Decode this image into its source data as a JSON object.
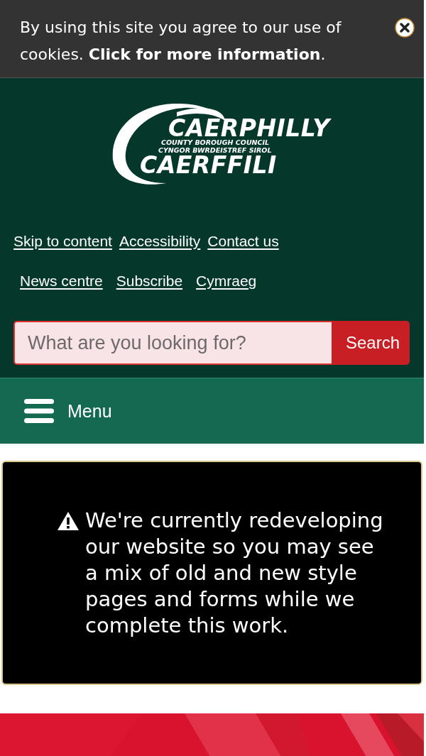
{
  "cookie_banner": {
    "text": "By using this site you agree to our use of cookies.",
    "link": "Click for more information",
    "text_after": "."
  },
  "logo": {
    "lines": [
      "CAERPHILLY",
      "COUNTY BOROUGH COUNCIL",
      "CYNGOR BWRDEISTREF SIROL",
      "CAERFFILI"
    ]
  },
  "link_rows": [
    [
      "Skip to content",
      "Accessibility",
      "Contact us"
    ],
    [
      "News centre",
      "Subscribe",
      "Cymraeg"
    ]
  ],
  "search": {
    "placeholder": "What are you looking for?",
    "button": "Search"
  },
  "menu": {
    "label": "Menu"
  },
  "notice": {
    "text": "We're currently redeveloping our website so you may see a mix of old and new style pages and forms while we complete this work."
  },
  "banner": {
    "kind": "picture"
  }
}
